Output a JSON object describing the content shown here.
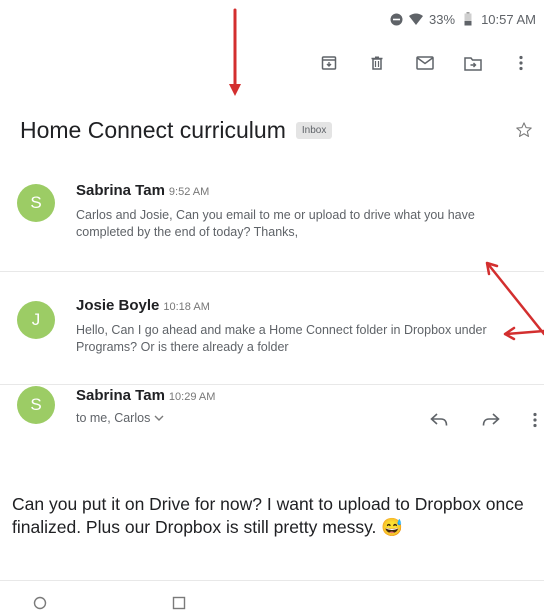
{
  "status_bar": {
    "battery": "33%",
    "time": "10:57 AM",
    "icons": [
      "dnd-icon",
      "wifi-icon",
      "battery-icon"
    ]
  },
  "toolbar": {
    "icons": [
      "archive-icon",
      "delete-icon",
      "mark-unread-icon",
      "move-to-icon",
      "more-vert-icon"
    ]
  },
  "email": {
    "subject": "Home Connect curriculum",
    "label": "Inbox",
    "starred": false
  },
  "messages": [
    {
      "initial": "S",
      "sender": "Sabrina Tam",
      "time": "9:52 AM",
      "snippet": "Carlos and Josie, Can you email to me or upload to drive what you have completed by the end of today? Thanks,",
      "avatar_color": "#9ccc65"
    },
    {
      "initial": "J",
      "sender": "Josie Boyle",
      "time": "10:18 AM",
      "snippet": "Hello, Can I go ahead and make a Home Connect folder in Dropbox under Programs? Or is there already a folder",
      "avatar_color": "#9ccc65"
    },
    {
      "initial": "S",
      "sender": "Sabrina Tam",
      "time": "10:29 AM",
      "recipients": "to me, Carlos",
      "body": "Can you put it on Drive for now? I want to upload to Dropbox once finalized.  Plus our Dropbox is still pretty messy. 😅",
      "avatar_color": "#9ccc65"
    }
  ],
  "colors": {
    "annotation_arrow": "#d32f2f"
  },
  "nav": {
    "icons": [
      "home-icon",
      "recents-icon"
    ]
  }
}
